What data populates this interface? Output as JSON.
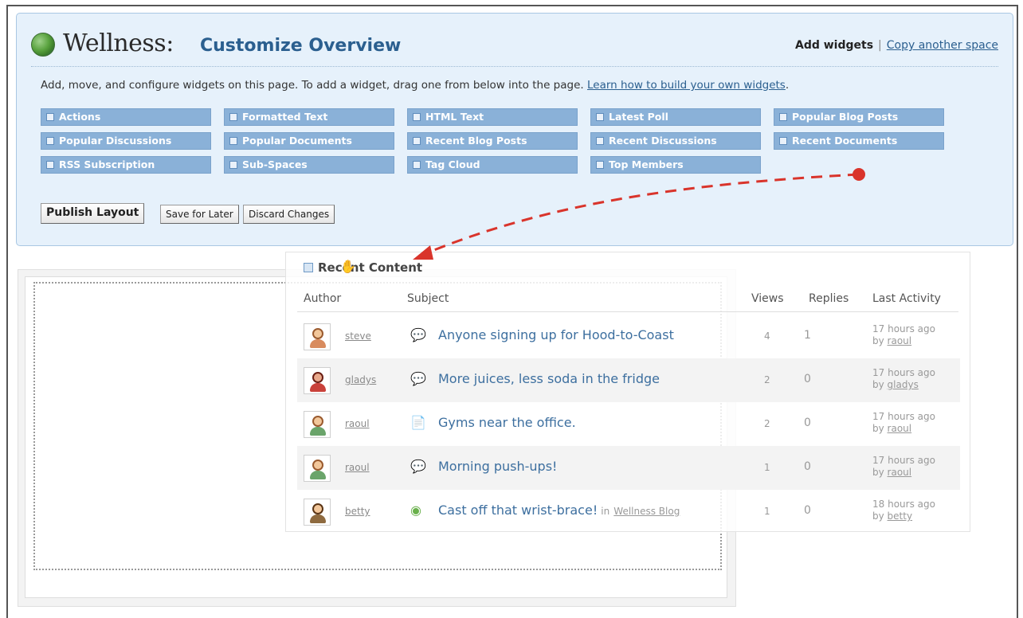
{
  "header": {
    "space_name": "Wellness:",
    "page_title": "Customize Overview",
    "add_widgets": "Add widgets",
    "separator": "|",
    "copy_space": "Copy another space"
  },
  "instructions": {
    "text": "Add, move, and configure widgets on this page. To add a widget, drag one from below into the page.",
    "learn_link": "Learn how to build your own widgets",
    "period": "."
  },
  "widgets": [
    "Actions",
    "Formatted Text",
    "HTML Text",
    "Latest Poll",
    "Popular Blog Posts",
    "Popular Discussions",
    "Popular Documents",
    "Recent Blog Posts",
    "Recent Discussions",
    "Recent Documents",
    "RSS Subscription",
    "Sub-Spaces",
    "Tag Cloud",
    "Top Members"
  ],
  "buttons": {
    "publish": "Publish Layout",
    "save_later": "Save for Later",
    "discard": "Discard Changes"
  },
  "dragged_widget": {
    "title": "Recent Content",
    "columns": {
      "author": "Author",
      "subject": "Subject",
      "views": "Views",
      "replies": "Replies",
      "last_activity": "Last Activity"
    },
    "rows": [
      {
        "author": "steve",
        "type": "discussion",
        "subject": "Anyone signing up for Hood-to-Coast",
        "in_label": "",
        "in_link": "",
        "views": "4",
        "replies": "1",
        "time": "17 hours ago",
        "by": "by",
        "by_user": "raoul"
      },
      {
        "author": "gladys",
        "type": "discussion",
        "subject": "More juices, less soda in the fridge",
        "in_label": "",
        "in_link": "",
        "views": "2",
        "replies": "0",
        "time": "17 hours ago",
        "by": "by",
        "by_user": "gladys"
      },
      {
        "author": "raoul",
        "type": "document",
        "subject": "Gyms near the office.",
        "in_label": "",
        "in_link": "",
        "views": "2",
        "replies": "0",
        "time": "17 hours ago",
        "by": "by",
        "by_user": "raoul"
      },
      {
        "author": "raoul",
        "type": "discussion",
        "subject": "Morning push-ups!",
        "in_label": "",
        "in_link": "",
        "views": "1",
        "replies": "0",
        "time": "17 hours ago",
        "by": "by",
        "by_user": "raoul"
      },
      {
        "author": "betty",
        "type": "blog",
        "subject": "Cast off that wrist-brace!",
        "in_label": "in",
        "in_link": "Wellness Blog",
        "views": "1",
        "replies": "0",
        "time": "18 hours ago",
        "by": "by",
        "by_user": "betty"
      }
    ]
  },
  "colors": {
    "panel_bg": "#e6f1fb",
    "widget_tile": "#8ab1d8",
    "link": "#2b5f8f",
    "arrow": "#d9342b"
  },
  "icons": {
    "logo": "globe-icon",
    "discussion": "discussion-icon",
    "document": "document-icon",
    "blog": "blog-icon",
    "cursor": "hand-cursor-icon"
  }
}
